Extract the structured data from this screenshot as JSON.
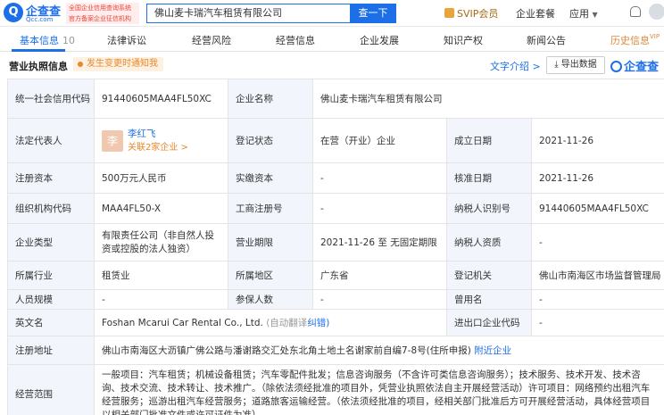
{
  "header": {
    "logo_text": "企查查",
    "logo_sub": "Qcc.com",
    "logo_tag_line1": "全国企业信用查询系统",
    "logo_tag_line2": "官方备案企业征信机构",
    "search_value": "佛山麦卡瑞汽车租赁有限公司",
    "search_button": "查一下",
    "svip_label": "SVIP会员",
    "links": [
      "企业套餐",
      "应用"
    ]
  },
  "tabs": [
    {
      "label": "基本信息",
      "count": "10"
    },
    {
      "label": "法律诉讼"
    },
    {
      "label": "经营风险"
    },
    {
      "label": "经营信息"
    },
    {
      "label": "企业发展"
    },
    {
      "label": "知识产权"
    },
    {
      "label": "新闻公告"
    },
    {
      "label": "历史信息",
      "badge": "VIP"
    }
  ],
  "section": {
    "title": "营业执照信息",
    "badge": "发生变更时通知我",
    "text_link": "文字介绍 >",
    "export_label": "导出数据",
    "brand": "企查查"
  },
  "info": {
    "credit_code_label": "统一社会信用代码",
    "credit_code": "91440605MAA4FL50XC",
    "company_name_label": "企业名称",
    "company_name": "佛山麦卡瑞汽车租赁有限公司",
    "legal_rep_label": "法定代表人",
    "legal_rep_avatar": "李",
    "legal_rep_name": "李红飞",
    "legal_rep_related": "关联2家企业 >",
    "status_label": "登记状态",
    "status": "在营（开业）企业",
    "founded_label": "成立日期",
    "founded": "2021-11-26",
    "reg_capital_label": "注册资本",
    "reg_capital": "500万元人民币",
    "paid_capital_label": "实缴资本",
    "paid_capital": "-",
    "approved_label": "核准日期",
    "approved": "2021-11-26",
    "org_code_label": "组织机构代码",
    "org_code": "MAA4FL50-X",
    "biz_reg_no_label": "工商注册号",
    "biz_reg_no": "-",
    "taxpayer_id_label": "纳税人识别号",
    "taxpayer_id": "91440605MAA4FL50XC",
    "company_type_label": "企业类型",
    "company_type": "有限责任公司（非自然人投资或控股的法人独资）",
    "biz_term_label": "营业期限",
    "biz_term": "2021-11-26 至 无固定期限",
    "taxpayer_qual_label": "纳税人资质",
    "taxpayer_qual": "-",
    "industry_label": "所属行业",
    "industry": "租赁业",
    "region_label": "所属地区",
    "region": "广东省",
    "reg_authority_label": "登记机关",
    "reg_authority": "佛山市南海区市场监督管理局",
    "staff_size_label": "人员规模",
    "staff_size": "-",
    "insured_label": "参保人数",
    "insured": "-",
    "former_name_label": "曾用名",
    "former_name": "-",
    "en_name_label": "英文名",
    "en_name": "Foshan Mcarui Car Rental Co., Ltd.",
    "en_name_hint": "(自动翻译",
    "en_name_fix": "纠错)",
    "import_export_label": "进出口企业代码",
    "import_export": "-",
    "address_label": "注册地址",
    "address": "佛山市南海区大沥镇广佛公路与潘谢路交汇处东北角土地土名谢家前自编7-8号(住所申报)",
    "address_link": "附近企业",
    "scope_label": "经营范围",
    "scope": "一般项目：汽车租赁；机械设备租赁；汽车零配件批发；信息咨询服务（不含许可类信息咨询服务）；技术服务、技术开发、技术咨询、技术交流、技术转让、技术推广。（除依法须经批准的项目外，凭营业执照依法自主开展经营活动）许可项目：网络预约出租汽车经营服务；巡游出租汽车经营服务；道路旅客运输经营。（依法须经批准的项目，经相关部门批准后方可开展经营活动，具体经营项目以相关部门批准文件或许可证件为准）"
  }
}
